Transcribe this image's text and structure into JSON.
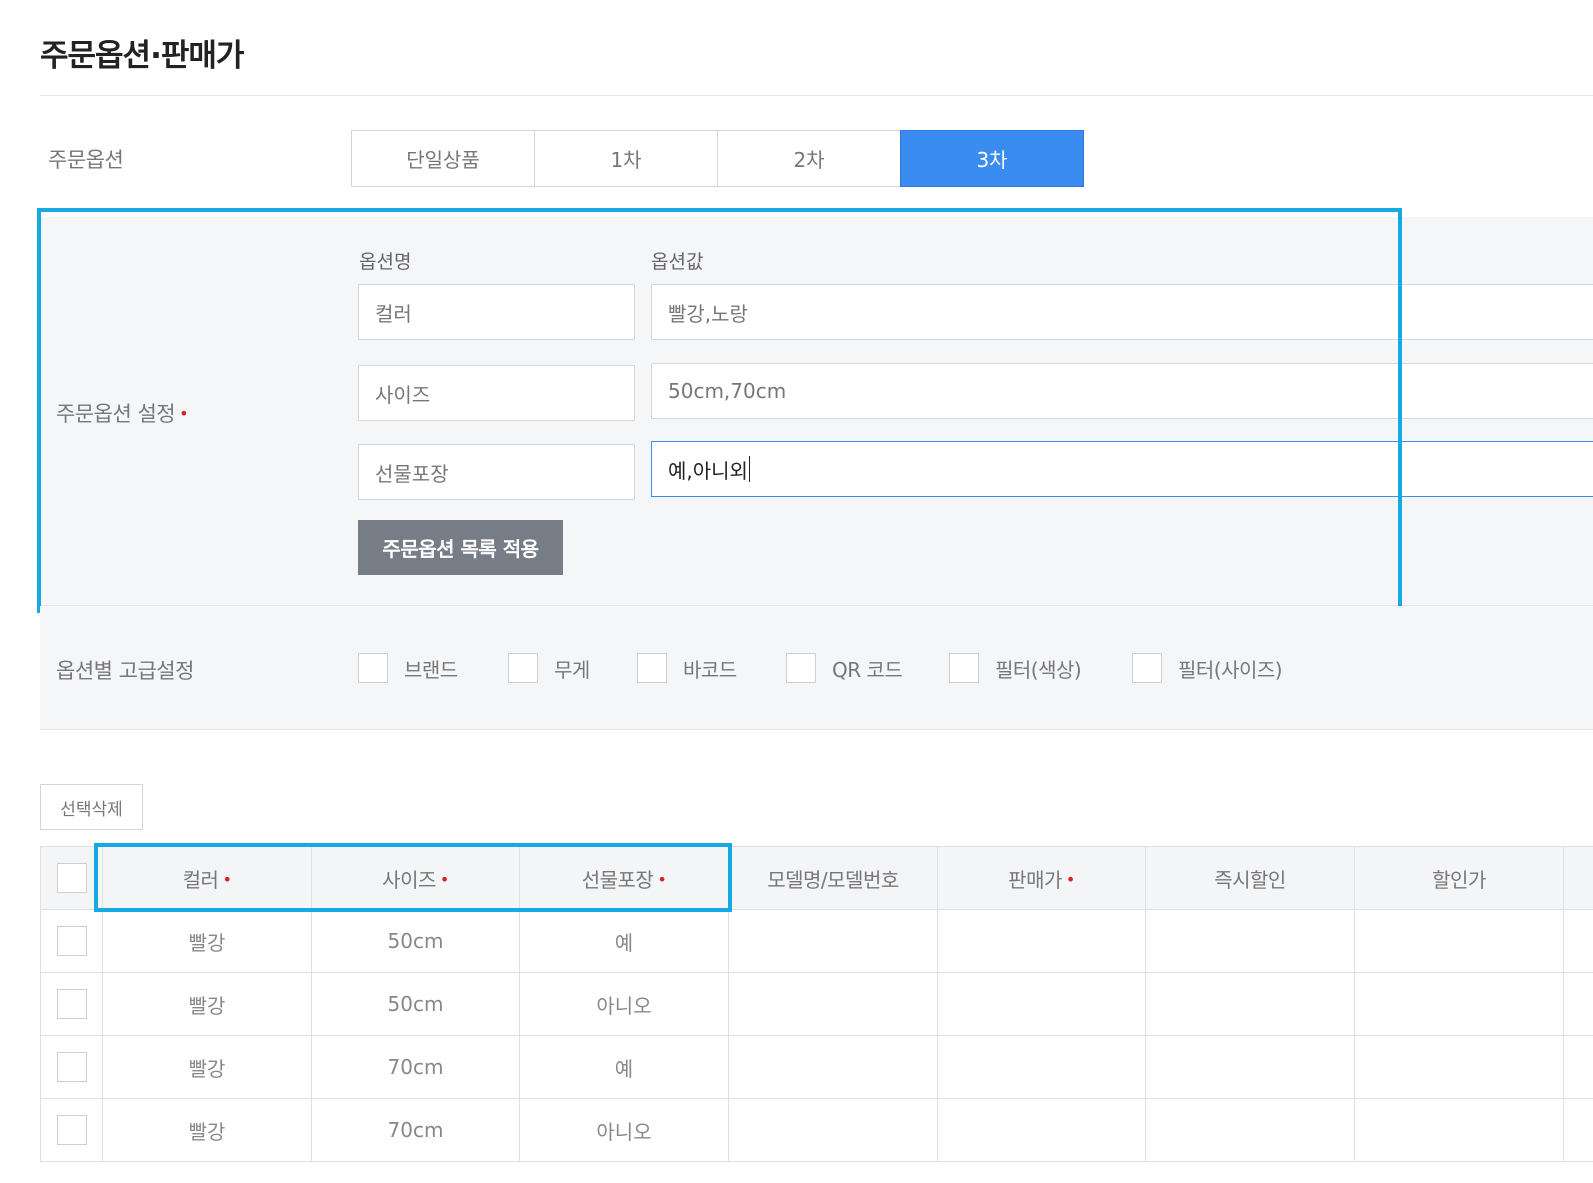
{
  "page": {
    "title": "주문옵션·판매가"
  },
  "order_option": {
    "label": "주문옵션",
    "tabs": [
      {
        "label": "단일상품",
        "active": false
      },
      {
        "label": "1차",
        "active": false
      },
      {
        "label": "2차",
        "active": false
      },
      {
        "label": "3차",
        "active": true
      }
    ]
  },
  "option_settings": {
    "label": "주문옵션 설정",
    "required_mark": "•",
    "name_header": "옵션명",
    "value_header": "옵션값",
    "rows": [
      {
        "name": "컬러",
        "value": "빨강,노랑"
      },
      {
        "name": "사이즈",
        "value": "50cm,70cm"
      },
      {
        "name": "선물포장",
        "value": "예,아니외"
      }
    ],
    "apply_label": "주문옵션 목록 적용"
  },
  "advanced": {
    "label": "옵션별 고급설정",
    "options": [
      {
        "label": "브랜드",
        "checked": false
      },
      {
        "label": "무게",
        "checked": false
      },
      {
        "label": "바코드",
        "checked": false
      },
      {
        "label": "QR 코드",
        "checked": false
      },
      {
        "label": "필터(색상)",
        "checked": false
      },
      {
        "label": "필터(사이즈)",
        "checked": false
      }
    ]
  },
  "table": {
    "delete_label": "선택삭제",
    "required_mark": "•",
    "columns": [
      {
        "label": "컬러",
        "required": true
      },
      {
        "label": "사이즈",
        "required": true
      },
      {
        "label": "선물포장",
        "required": true
      },
      {
        "label": "모델명/모델번호",
        "required": false
      },
      {
        "label": "판매가",
        "required": true
      },
      {
        "label": "즉시할인",
        "required": false
      },
      {
        "label": "할인가",
        "required": false
      }
    ],
    "rows": [
      {
        "color": "빨강",
        "size": "50cm",
        "gift": "예"
      },
      {
        "color": "빨강",
        "size": "50cm",
        "gift": "아니오"
      },
      {
        "color": "빨강",
        "size": "70cm",
        "gift": "예"
      },
      {
        "color": "빨강",
        "size": "70cm",
        "gift": "아니오"
      }
    ]
  },
  "colors": {
    "accent": "#3b8cf0",
    "highlight": "#17a9e1",
    "required": "#e02020",
    "apply_button": "#777d86"
  }
}
